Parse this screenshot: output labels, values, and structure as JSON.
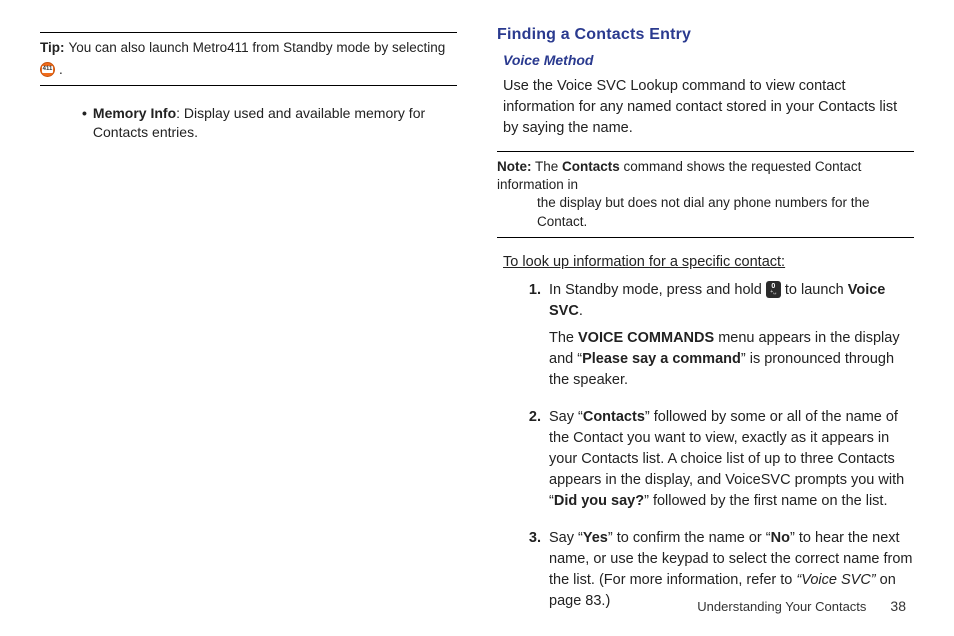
{
  "left": {
    "tip": {
      "label": "Tip:",
      "before": "You can also launch Metro411 from Standby mode by selecting",
      "icon_name": "411-icon",
      "icon_inner": "411",
      "after": "."
    },
    "bullet": {
      "marker": "•",
      "bold": "Memory Info",
      "rest": ": Display used and available memory for Contacts entries."
    }
  },
  "right": {
    "heading": "Finding a Contacts Entry",
    "sub": "Voice Method",
    "intro": "Use the Voice SVC Lookup command to view contact information for any named contact stored in your Contacts list by saying the name.",
    "note": {
      "label": "Note:",
      "l1a": "The ",
      "l1b": "Contacts",
      "l1c": " command shows the requested Contact information in",
      "l2": "the display but does not dial any phone numbers for the Contact."
    },
    "lookup": "To look up information for a specific contact:",
    "s1": {
      "num": "1.",
      "a": "In Standby mode, press and hold ",
      "key_top": "0",
      "key_bot": "+␣",
      "b": " to launch ",
      "c": "Voice SVC",
      "d": ".",
      "p2a": "The ",
      "p2b": "VOICE COMMANDS",
      "p2c": " menu appears in the display and “",
      "p2d": "Please say a command",
      "p2e": "” is pronounced through the speaker."
    },
    "s2": {
      "num": "2.",
      "a": "Say “",
      "b": "Contacts",
      "c": "” followed by some or all of the name of the Contact you want to view, exactly as it appears in your Contacts list. A choice list of up to three Contacts appears in the display, and VoiceSVC prompts you with “",
      "d": "Did you say?",
      "e": "” followed by the first name on the list."
    },
    "s3": {
      "num": "3.",
      "a": "Say “",
      "b": "Yes",
      "c": "” to confirm the name or “",
      "d": "No",
      "e": "” to hear the next name, or use the keypad to select the correct name from the list. (For more information, refer to ",
      "f": "“Voice SVC”",
      "g": " on page 83.)"
    }
  },
  "footer": {
    "section": "Understanding Your Contacts",
    "page": "38"
  }
}
